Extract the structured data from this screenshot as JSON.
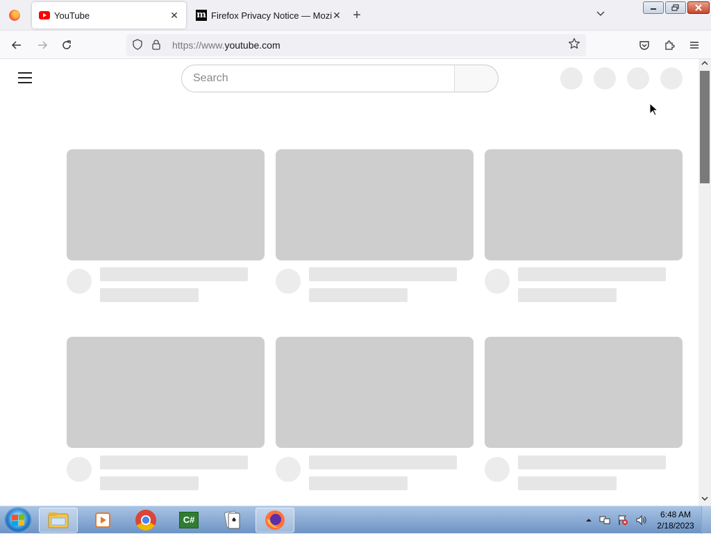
{
  "browser": {
    "tabs": [
      {
        "title": "YouTube",
        "active": true
      },
      {
        "title": "Firefox Privacy Notice — Mozilla",
        "active": false
      }
    ],
    "new_tab": "+",
    "tab_close": "✕",
    "url_prefix": "https://www.",
    "url_domain": "youtube.com"
  },
  "page": {
    "search_placeholder": "Search"
  },
  "taskbar": {
    "time": "6:48 AM",
    "date": "2/18/2023",
    "csharp_label": "C#"
  },
  "colors": {
    "skeleton_thumb": "#cecece",
    "skeleton_text": "#e6e6e6",
    "youtube_red": "#ff0000",
    "taskbar": "#6d93c4"
  }
}
